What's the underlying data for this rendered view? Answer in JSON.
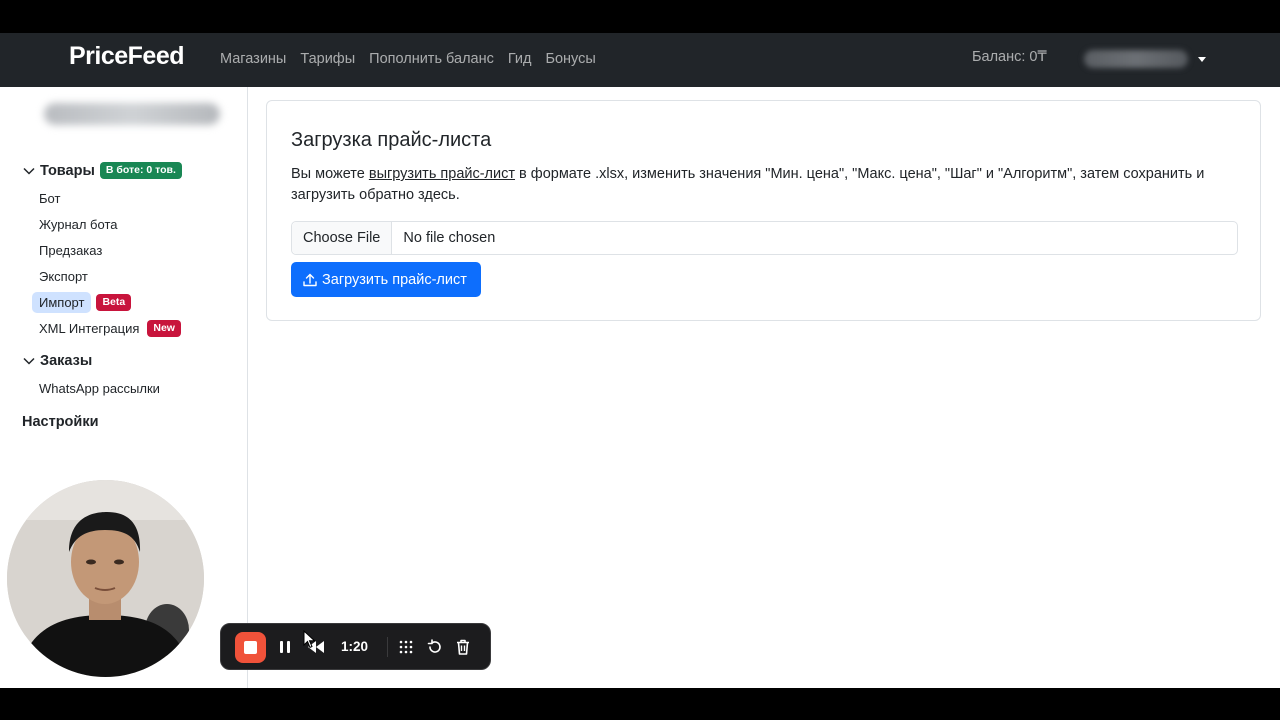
{
  "navbar": {
    "brand": "PriceFeed",
    "links": [
      "Магазины",
      "Тарифы",
      "Пополнить баланс",
      "Гид",
      "Бонусы"
    ],
    "balance": "Баланс: 0₸"
  },
  "sidebar": {
    "products": {
      "title": "Товары",
      "badge": "В боте: 0 тов."
    },
    "items": [
      {
        "label": "Бот"
      },
      {
        "label": "Журнал бота"
      },
      {
        "label": "Предзаказ"
      },
      {
        "label": "Экспорт"
      },
      {
        "label": "Импорт",
        "badge": "Beta"
      },
      {
        "label": "XML Интеграция",
        "badge": "New"
      }
    ],
    "orders": {
      "title": "Заказы"
    },
    "orders_items": [
      {
        "label": "WhatsApp рассылки"
      }
    ],
    "settings": {
      "title": "Настройки"
    }
  },
  "card": {
    "title": "Загрузка прайс-листа",
    "text_before": "Вы можете ",
    "link": "выгрузить прайс-лист",
    "text_after": " в формате .xlsx, изменить значения \"Мин. цена\", \"Макс. цена\", \"Шаг\" и \"Алгоритм\", затем сохранить и загрузить обратно здесь.",
    "file_button": "Choose File",
    "file_status": "No file chosen",
    "upload_button": "Загрузить прайс-лист"
  },
  "recorder": {
    "time": "1:20"
  },
  "colors": {
    "navbar": "#212529",
    "primary": "#0d6efd",
    "badge_green": "#198754",
    "badge_red": "#c8143c",
    "active_item": "#cfe2ff",
    "stop": "#f0523a"
  },
  "icons": [
    "chevron-down-icon",
    "upload-icon",
    "stop-icon",
    "pause-icon",
    "rewind-icon",
    "grid-icon",
    "restart-icon",
    "trash-icon",
    "mouse-cursor-icon",
    "caret-down-icon"
  ]
}
